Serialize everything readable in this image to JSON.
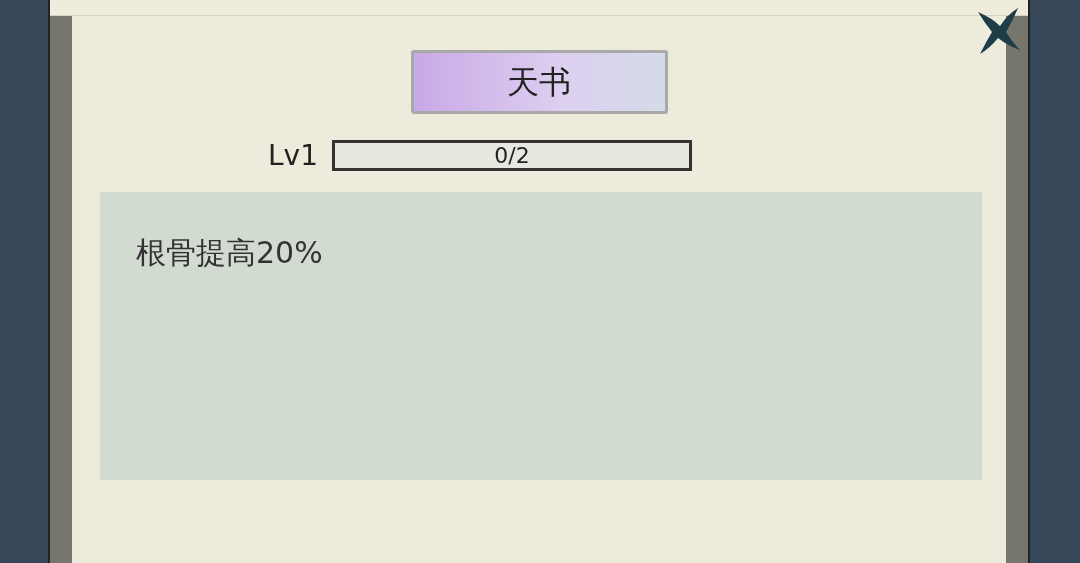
{
  "title": "天书",
  "level_label": "Lv1",
  "progress": {
    "level": 0,
    "reading": "0/2"
  },
  "description": "根骨提高20%"
}
